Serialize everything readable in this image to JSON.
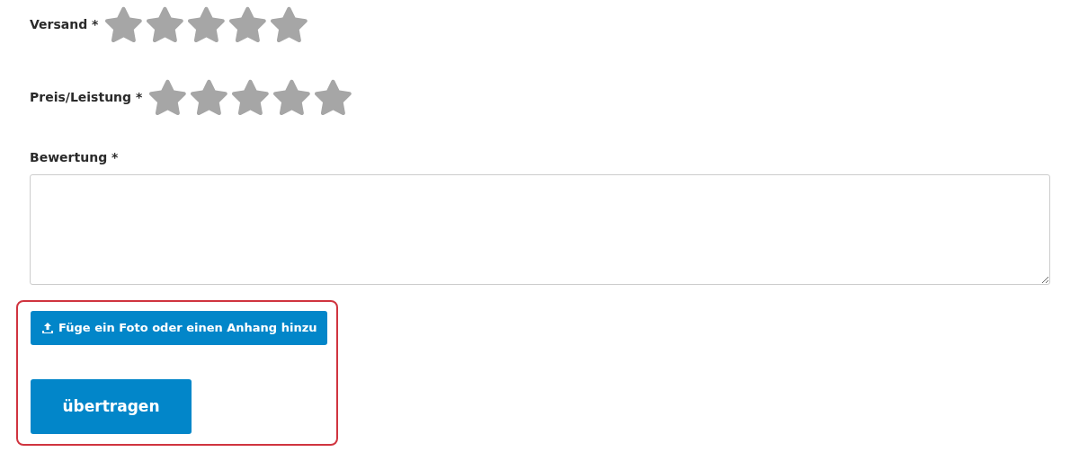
{
  "ratings": [
    {
      "label": "Versand *",
      "stars": 0
    },
    {
      "label": "Preis/Leistung *",
      "stars": 0
    }
  ],
  "review": {
    "label": "Bewertung *"
  },
  "attach_button": {
    "label": "Füge ein Foto oder einen Anhang hinzu"
  },
  "submit_button": {
    "label": "übertragen"
  }
}
